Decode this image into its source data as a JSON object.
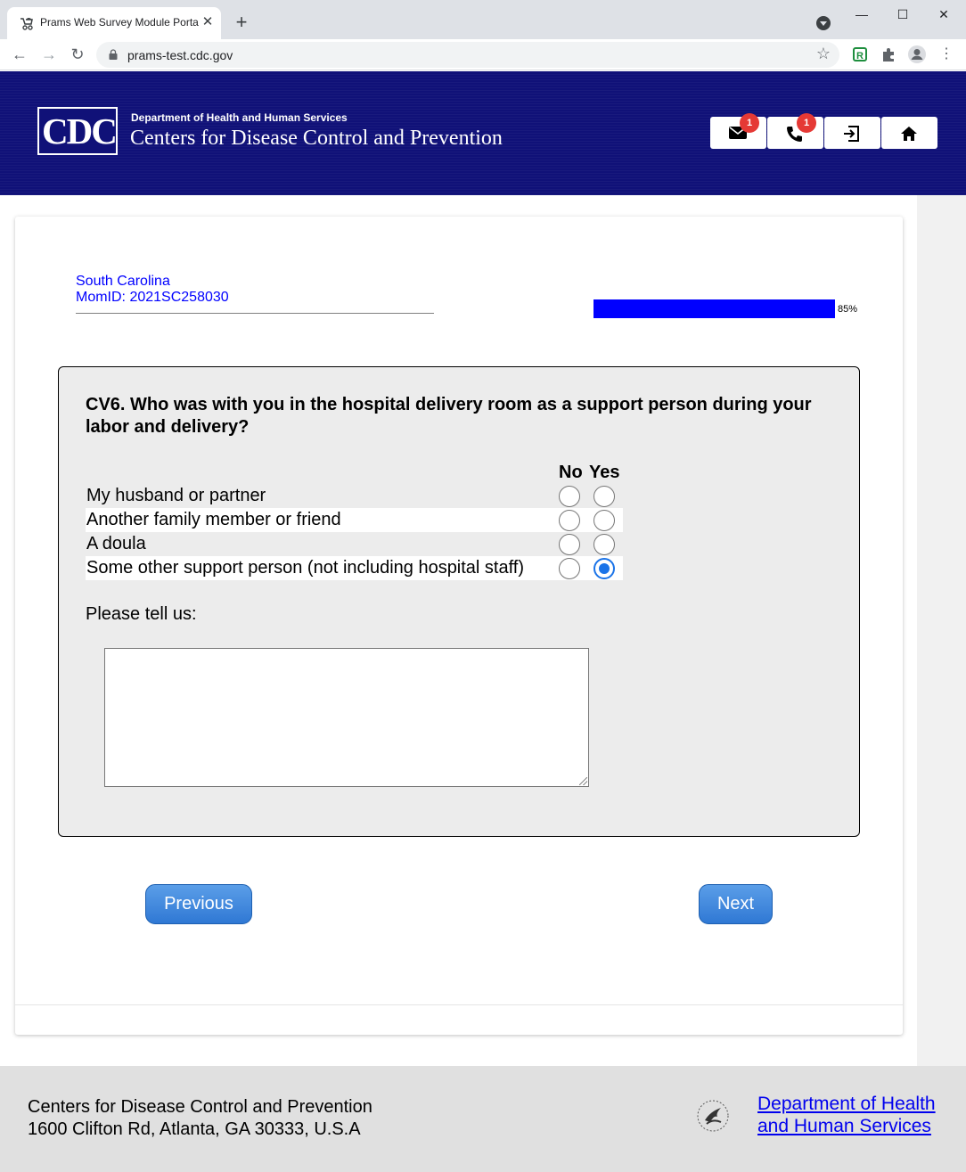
{
  "browser": {
    "tab_title": "Prams Web Survey Module Portal",
    "tab_close": "✕",
    "new_tab": "+",
    "url": "prams-test.cdc.gov",
    "window_controls": {
      "minimize": "—",
      "maximize": "☐",
      "close": "✕"
    }
  },
  "header": {
    "logo_text": "CDC",
    "department": "Department of Health and Human Services",
    "agency": "Centers for Disease Control and Prevention",
    "buttons": [
      {
        "name": "messages",
        "icon": "envelope-icon",
        "badge": "1"
      },
      {
        "name": "phone",
        "icon": "phone-icon",
        "badge": "1"
      },
      {
        "name": "logout",
        "icon": "exit-icon"
      },
      {
        "name": "home",
        "icon": "home-icon"
      }
    ]
  },
  "respondent": {
    "state": "South Carolina",
    "mom_id": "MomID: 2021SC258030"
  },
  "progress": {
    "value": 0.85,
    "label": "85%",
    "color": "#0000ff"
  },
  "question": {
    "text": "CV6. Who was with you in the hospital delivery room as a support person during your labor and delivery?",
    "col_no": "No",
    "col_yes": "Yes",
    "rows": [
      {
        "label": "My husband or partner",
        "answer": null
      },
      {
        "label": "Another family member or friend",
        "answer": null
      },
      {
        "label": "A doula",
        "answer": null
      },
      {
        "label": "Some other support person (not including hospital staff)",
        "answer": "Yes"
      }
    ],
    "followup_label": "Please tell us:",
    "followup_value": ""
  },
  "navigation": {
    "previous_label": "Previous",
    "next_label": "Next",
    "button_color": "#2f78d4"
  },
  "footer": {
    "org": "Centers for Disease Control and Prevention",
    "address": "1600 Clifton Rd, Atlanta, GA 30333, U.S.A",
    "hhs_line1": "Department of Health",
    "hhs_line2": "and Human Services"
  }
}
